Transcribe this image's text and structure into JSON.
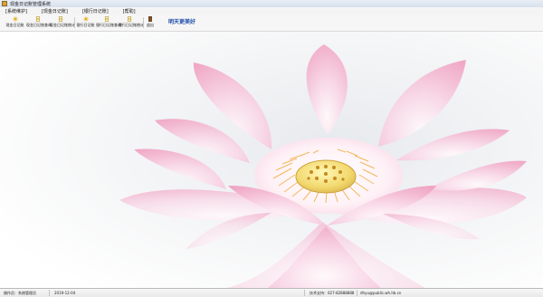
{
  "window": {
    "title": "现金日记账管理系统"
  },
  "menu": {
    "items": [
      "[系统维护]",
      "[现金日记账]",
      "[银行日记账]",
      "[帮助]"
    ]
  },
  "toolbar": {
    "buttons": [
      {
        "label": "现金日记账",
        "icon": "sparkle-icon"
      },
      {
        "label": "现金日记账查询",
        "icon": "document-icon"
      },
      {
        "label": "现金日记账统计",
        "icon": "document-icon"
      },
      {
        "label": "银行日记账",
        "icon": "sparkle-icon"
      },
      {
        "label": "银行日记账查询",
        "icon": "document-icon"
      },
      {
        "label": "银行日记账统计",
        "icon": "document-icon"
      },
      {
        "label": "退出",
        "icon": "exit-icon"
      }
    ],
    "note": "明天更美好"
  },
  "status": {
    "operator": "操作员：系统管理员",
    "date": "2019-12-04",
    "phone": "技术支持：027-82888888",
    "email": "dhyu@public.wh.hb.cn"
  },
  "colors": {
    "accent": "#1f4fa8",
    "lotus": "#f2a9c6",
    "petal_light": "#fde6ef"
  }
}
